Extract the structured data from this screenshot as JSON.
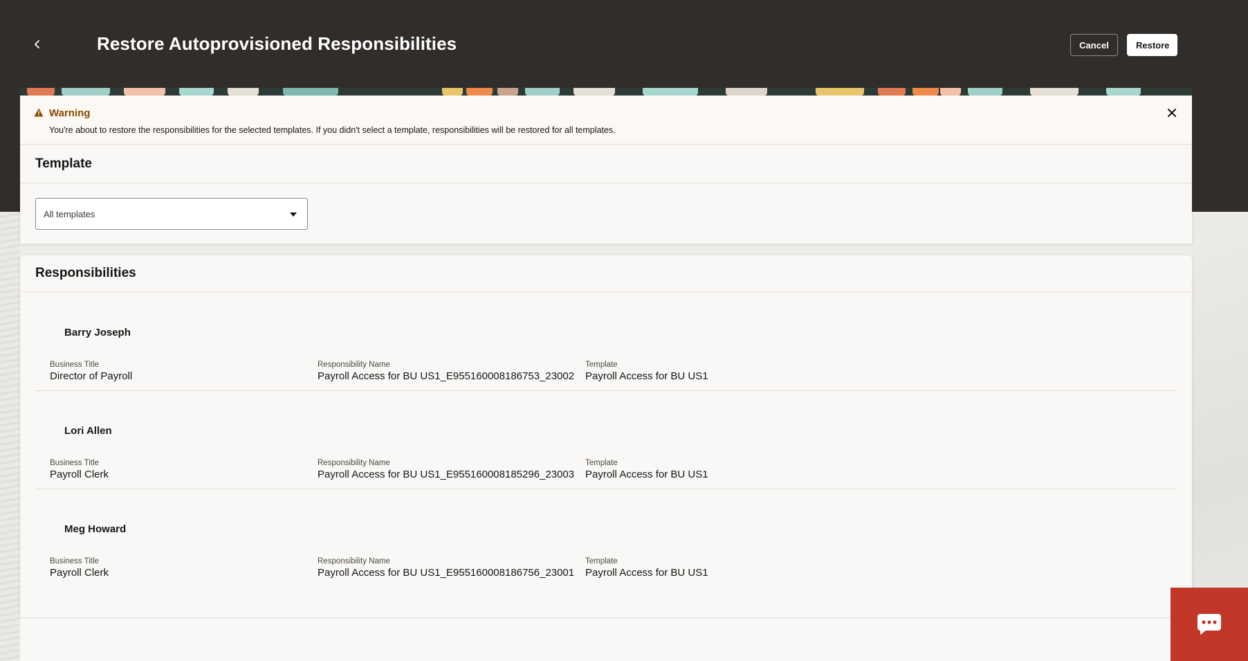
{
  "header": {
    "title": "Restore Autoprovisioned Responsibilities",
    "cancel_label": "Cancel",
    "restore_label": "Restore"
  },
  "warning": {
    "title": "Warning",
    "message": "You're about to restore the responsibilities for the selected templates. If you didn't select a template, responsibilities will be restored for all templates."
  },
  "template_section": {
    "heading": "Template",
    "select_value": "All templates"
  },
  "responsibilities_section": {
    "heading": "Responsibilities",
    "labels": {
      "business_title": "Business Title",
      "responsibility_name": "Responsibility Name",
      "template": "Template"
    },
    "rows": [
      {
        "name": "Barry Joseph",
        "business_title": "Director of Payroll",
        "responsibility_name": "Payroll Access for BU US1_E955160008186753_23002",
        "template": "Payroll Access for BU US1"
      },
      {
        "name": "Lori Allen",
        "business_title": "Payroll Clerk",
        "responsibility_name": "Payroll Access for BU US1_E955160008185296_23003",
        "template": "Payroll Access for BU US1"
      },
      {
        "name": "Meg Howard",
        "business_title": "Payroll Clerk",
        "responsibility_name": "Payroll Access for BU US1_E955160008186756_23001",
        "template": "Payroll Access for BU US1"
      }
    ]
  },
  "icons": {
    "back": "chevron-left-icon",
    "warning": "warning-triangle-icon",
    "close": "close-icon",
    "dropdown": "caret-down-icon",
    "chat": "chat-bubble-icon"
  },
  "colors": {
    "header_bg": "#312d2a",
    "warning_text": "#8a4b00",
    "chat_button": "#c2372a"
  }
}
